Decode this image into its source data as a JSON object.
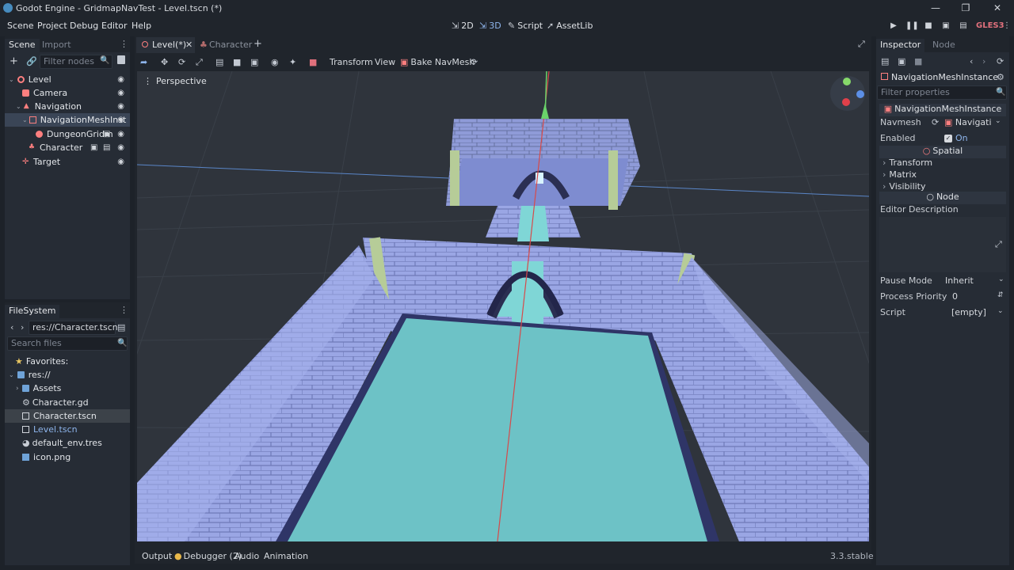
{
  "window": {
    "title": "Godot Engine - GridmapNavTest - Level.tscn (*)"
  },
  "menu": {
    "items": [
      "Scene",
      "Project",
      "Debug",
      "Editor",
      "Help"
    ]
  },
  "modes": {
    "m2d": "2D",
    "m3d": "3D",
    "script": "Script",
    "assetlib": "AssetLib"
  },
  "renderer": "GLES3",
  "scene_dock": {
    "tabs": [
      "Scene",
      "Import"
    ],
    "filter_placeholder": "Filter nodes",
    "nodes": [
      {
        "name": "Level"
      },
      {
        "name": "Camera"
      },
      {
        "name": "Navigation"
      },
      {
        "name": "NavigationMeshInst"
      },
      {
        "name": "DungeonGridm"
      },
      {
        "name": "Character"
      },
      {
        "name": "Target"
      }
    ]
  },
  "filesystem": {
    "tab": "FileSystem",
    "path": "res://Character.tscn",
    "search_placeholder": "Search files",
    "favorites": "Favorites:",
    "root": "res://",
    "items": [
      "Assets",
      "Character.gd",
      "Character.tscn",
      "Level.tscn",
      "default_env.tres",
      "icon.png"
    ]
  },
  "editor": {
    "tabs": [
      "Level(*)",
      "Character"
    ],
    "toolbar": {
      "transform": "Transform",
      "view": "View",
      "bake": "Bake NavMesh"
    },
    "viewport_label": "Perspective"
  },
  "bottom_panel": {
    "tabs": [
      "Output",
      "Debugger (2)",
      "Audio",
      "Animation"
    ],
    "version": "3.3.stable"
  },
  "inspector": {
    "tabs": [
      "Inspector",
      "Node"
    ],
    "object": "NavigationMeshInstance",
    "filter_placeholder": "Filter properties",
    "class_header": "NavigationMeshInstance",
    "navmesh_label": "Navmesh",
    "navmesh_value": "Navigati",
    "enabled_label": "Enabled",
    "enabled_value": "On",
    "spatial_header": "Spatial",
    "groups": [
      "Transform",
      "Matrix",
      "Visibility"
    ],
    "node_header": "Node",
    "editor_description": "Editor Description",
    "pause_label": "Pause Mode",
    "pause_value": "Inherit",
    "priority_label": "Process Priority",
    "priority_value": "0",
    "script_label": "Script",
    "script_value": "[empty]"
  }
}
